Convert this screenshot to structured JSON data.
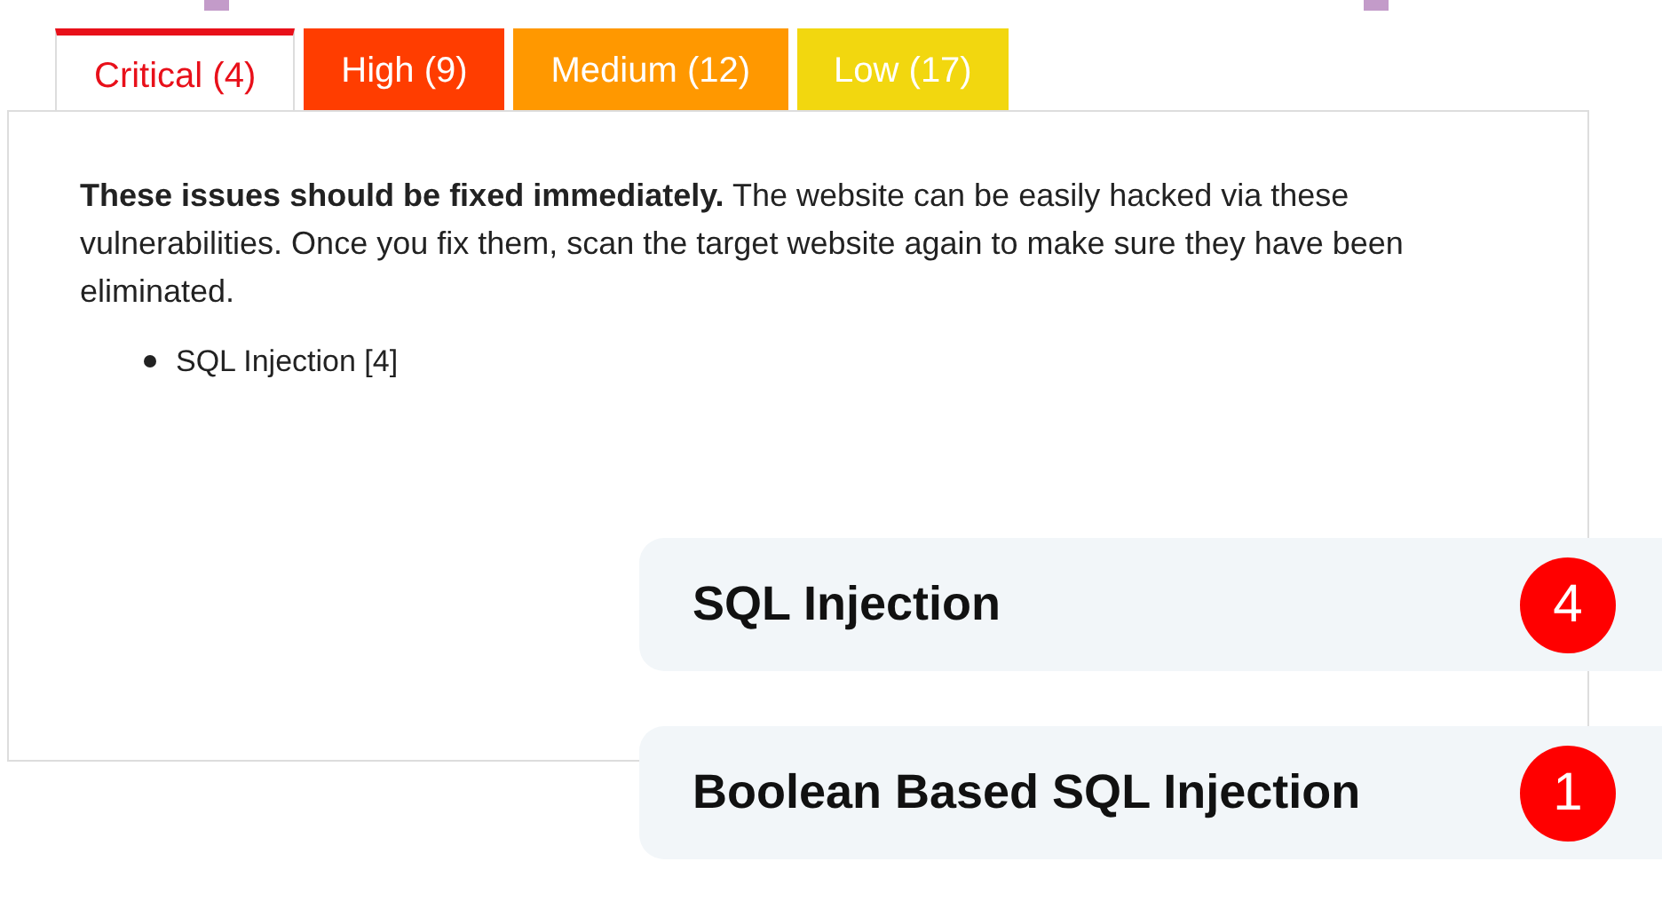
{
  "tabs": [
    {
      "label": "Critical (4)",
      "selected": true,
      "color": "#e8101a"
    },
    {
      "label": "High (9)",
      "selected": false,
      "color": "#ff3d00"
    },
    {
      "label": "Medium (12)",
      "selected": false,
      "color": "#ff9800"
    },
    {
      "label": "Low (17)",
      "selected": false,
      "color": "#f2d70f"
    }
  ],
  "panel": {
    "description": "**These issues should be fixed immediately.** The website can be easily hacked via these vulnerabilities. Once you fix them, scan the target website again to make sure they have been eliminated.",
    "issues": [
      "SQL Injection [4]"
    ]
  },
  "cards": [
    {
      "title": "SQL Injection",
      "count": "4"
    },
    {
      "title": "Boolean Based SQL Injection",
      "count": "1"
    }
  ]
}
